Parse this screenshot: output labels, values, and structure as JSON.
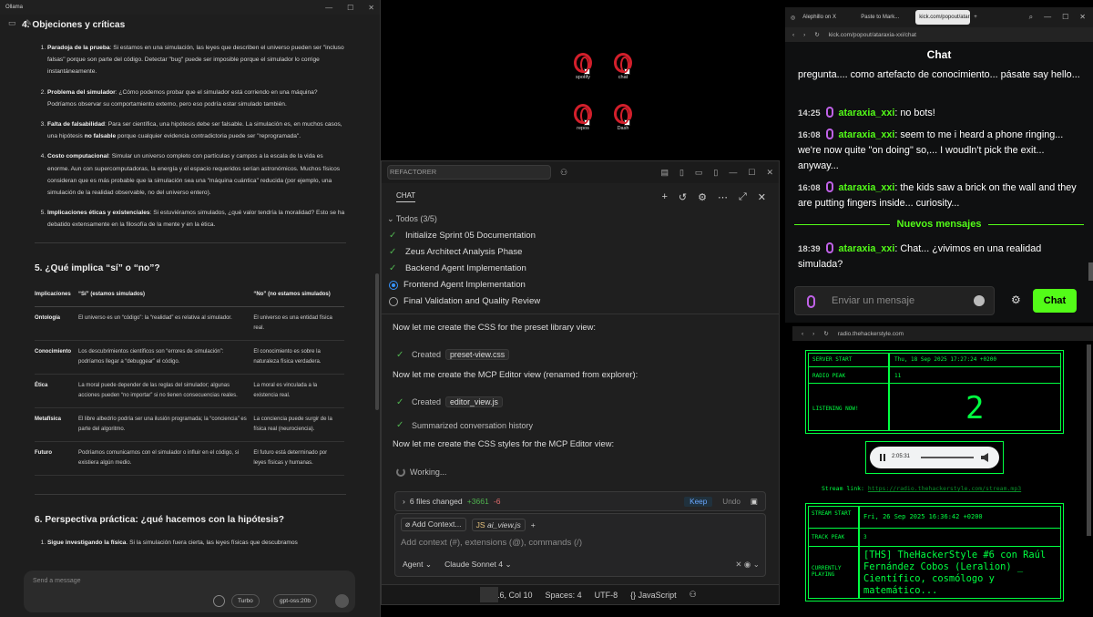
{
  "ollama": {
    "window_title": "Ollama",
    "section4_title": "4. Objeciones y críticas",
    "objections": [
      {
        "title": "Paradoja de la prueba",
        "text": ": Si estamos en una simulación, las leyes que describen el universo pueden ser \"incluso falsas\" porque son parte del código. Detectar \"bug\" puede ser imposible porque el simulador lo corrige instantáneamente."
      },
      {
        "title": "Problema del simulador",
        "text": ": ¿Cómo podemos probar que el simulador está corriendo en una máquina? Podríamos observar su comportamiento externo, pero eso podría estar simulado también."
      },
      {
        "title": "Falta de falsabilidad",
        "text_a": ": Para ser científica, una hipótesis debe ser falsable. La simulación es, en muchos casos, una hipótesis ",
        "bold": "no falsable",
        "text_b": " porque cualquier evidencia contradictoria puede ser \"reprogramada\"."
      },
      {
        "title": "Costo computacional",
        "text": ": Simular un universo completo con partículas y campos a la escala de la vida es enorme. Aun con supercomputadoras, la energía y el espacio requeridos serían astronómicos. Muchos físicos consideran que es más probable que la simulación sea una \"máquina cuántica\" reducida (por ejemplo, una simulación de la realidad observable, no del universo entero)."
      },
      {
        "title": "Implicaciones éticas y existenciales",
        "text": ": Si estuviéramos simulados, ¿qué valor tendría la moralidad? Esto se ha debatido extensamente en la filosofía de la mente y en la ética."
      }
    ],
    "section5_title": "5. ¿Qué implica “sí” o “no”?",
    "table": {
      "headers": [
        "Implicaciones",
        "“Sí” (estamos simulados)",
        "“No” (no estamos simulados)"
      ],
      "rows": [
        [
          "Ontología",
          "El universo es un “código”: la “realidad” es relativa al simulador.",
          "El universo es una entidad física real."
        ],
        [
          "Conocimiento",
          "Los descubrimientos científicos son “errores de simulación”: podríamos llegar a “debuggear” el código.",
          "El conocimiento es sobre la naturaleza física verdadera."
        ],
        [
          "Ética",
          "La moral puede depender de las reglas del simulador; algunas acciones pueden “no importar” si no tienen consecuencias reales.",
          "La moral es vinculada a la existencia real."
        ],
        [
          "Metafísica",
          "El libre albedrío podría ser una ilusión programada; la “conciencia” es parte del algoritmo.",
          "La conciencia puede surgir de la física real (neurociencia)."
        ],
        [
          "Futuro",
          "Podríamos comunicarnos con el simulador o influir en el código, si existiera algún medio.",
          "El futuro está determinado por leyes físicas y humanas."
        ]
      ]
    },
    "section6_title": "6. Perspectiva práctica: ¿qué hacemos con la hipótesis?",
    "practical": [
      {
        "title": "Sigue investigando la física",
        "text": ". Si la simulación fuera cierta, las leyes físicas que descubramos"
      }
    ],
    "composer_placeholder": "Send a message",
    "turbo_label": "Turbo",
    "model_label": "gpt-oss:20b"
  },
  "desktop": {
    "icons": [
      "spotify",
      "chat",
      "repos",
      "Dash"
    ]
  },
  "vscode": {
    "command_center": "REFACTORER",
    "chat_tab": "CHAT",
    "todos_label": "Todos (3/5)",
    "todos": [
      {
        "label": "Initialize Sprint 05 Documentation",
        "status": "done"
      },
      {
        "label": "Zeus Architect Analysis Phase",
        "status": "done"
      },
      {
        "label": "Backend Agent Implementation",
        "status": "done"
      },
      {
        "label": "Frontend Agent Implementation",
        "status": "in-progress"
      },
      {
        "label": "Final Validation and Quality Review",
        "status": "pending"
      }
    ],
    "msg1": "Now let me create the CSS for the preset library view:",
    "created1_label": "Created",
    "created1_file": "preset-view.css",
    "msg2": "Now let me create the MCP Editor view (renamed from explorer):",
    "created2_label": "Created",
    "created2_file": "editor_view.js",
    "summarized": "Summarized conversation history",
    "msg3": "Now let me create the CSS styles for the MCP Editor view:",
    "working": "Working...",
    "files_changed": "6 files changed",
    "added": "+3661",
    "removed": "-6",
    "keep": "Keep",
    "undo": "Undo",
    "add_context": "Add Context...",
    "context_file": "ai_view.js",
    "input_placeholder": "Add context (#), extensions (@), commands (/)",
    "mode": "Agent",
    "model": "Claude Sonnet 4",
    "status_pos": "Ln 16, Col 10",
    "status_spaces": "Spaces: 4",
    "status_enc": "UTF-8",
    "status_lang": "JavaScript"
  },
  "kick": {
    "tabs": [
      "Alephillo on X",
      "Paste to Mark...",
      "kick.com/popout/ataraxia..."
    ],
    "url": "kick.com/popout/ataraxia-xxi/chat",
    "chat_title": "Chat",
    "first_line": "pregunta.... como artefacto de conocimiento... pásate say hello...",
    "messages": [
      {
        "time": "14:25",
        "user": "ataraxia_xxi",
        "text": ": no bots!"
      },
      {
        "time": "16:08",
        "user": "ataraxia_xxi",
        "text": ": seem to me i heard a phone ringing... we're now quite \"on doing\" so,... I woudln't pick the exit... anyway..."
      },
      {
        "time": "16:08",
        "user": "ataraxia_xxi",
        "text": ": the kids saw a brick on the wall and they are putting fingers inside... curiosity..."
      },
      {
        "time": "18:39",
        "user": "ataraxia_xxi",
        "text": ": Chat... ¿vivimos en una realidad simulada?"
      }
    ],
    "new_messages": "Nuevos mensajes",
    "input_placeholder": "Enviar un mensaje",
    "chat_button": "Chat",
    "accent": "#53fc18"
  },
  "radio": {
    "url": "radio.thehackerstyle.com",
    "server_start_label": "SERVER START",
    "server_start_value": "Thu, 18 Sep 2025 17:27:24 +0200",
    "radio_peak_label": "RADIO PEAK",
    "radio_peak_value": "11",
    "listening_label": "LISTENING NOW!",
    "listening_value": "2",
    "player_time": "2:05:31",
    "stream_label": "Stream link:",
    "stream_url": "https://radio.thehackerstyle.com/stream.mp3",
    "stream_start_label": "STREAM START",
    "stream_start_value": "Fri, 26 Sep 2025 16:36:42 +0200",
    "track_peak_label": "TRACK PEAK",
    "track_peak_value": "3",
    "playing_label": "CURRENTLY PLAYING",
    "playing_value": "[THS] TheHackerStyle #6 con Raúl Fernández Cobos (Leralion) _ Científico, cosmólogo y matemático...",
    "accent": "#00ff41"
  }
}
